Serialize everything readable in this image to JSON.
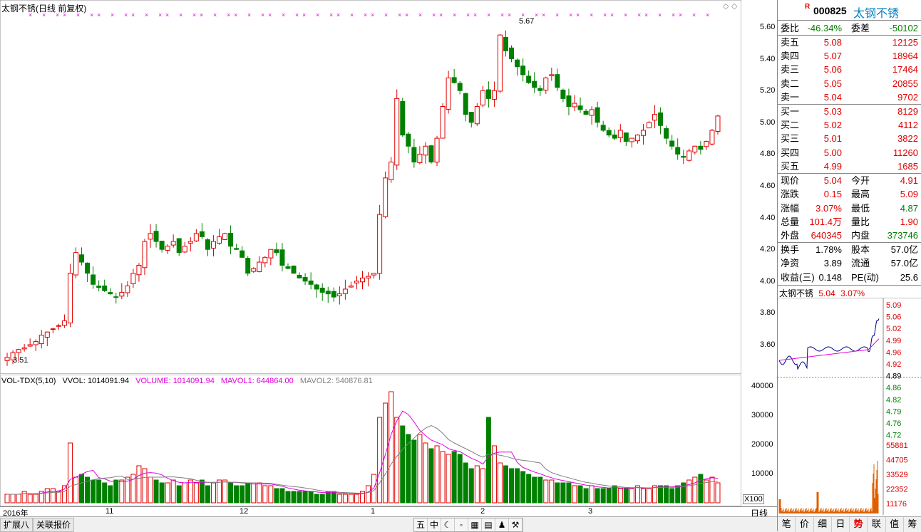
{
  "main_chart": {
    "title": "太钢不锈(日线 前复权)",
    "high_label": "5.67",
    "low_label": "3.51",
    "price_ticks": [
      "5.60",
      "5.40",
      "5.20",
      "5.00",
      "4.80",
      "4.60",
      "4.40",
      "4.20",
      "4.00",
      "3.80",
      "3.60"
    ],
    "date_labels": [
      "2016年",
      "11",
      "12",
      "1",
      "2",
      "3"
    ],
    "period": "日线"
  },
  "volume_chart": {
    "indicator": "VOL-TDX(5,10)",
    "vvol": "VVOL: 1014091.94",
    "volume": "VOLUME: 1014091.94",
    "mavol1": "MAVOL1: 644864.00",
    "mavol2": "MAVOL2: 540876.81",
    "ticks": [
      "40000",
      "30000",
      "20000",
      "10000"
    ],
    "unit": "X100"
  },
  "bottom_bar": {
    "tab1": "扩展八",
    "tab2": "关联报价",
    "tools": [
      "五",
      "中",
      "☾",
      "◦",
      "▦",
      "▤",
      "♟",
      "⚒"
    ]
  },
  "quote": {
    "code": "000825",
    "name": "太钢不锈",
    "badge": "R",
    "weibi_label": "委比",
    "weibi": "-46.34%",
    "weicha_label": "委差",
    "weicha": "-50102",
    "asks": [
      {
        "label": "卖五",
        "price": "5.08",
        "vol": "12125"
      },
      {
        "label": "卖四",
        "price": "5.07",
        "vol": "18964"
      },
      {
        "label": "卖三",
        "price": "5.06",
        "vol": "17464"
      },
      {
        "label": "卖二",
        "price": "5.05",
        "vol": "20855"
      },
      {
        "label": "卖一",
        "price": "5.04",
        "vol": "9702"
      }
    ],
    "bids": [
      {
        "label": "买一",
        "price": "5.03",
        "vol": "8129"
      },
      {
        "label": "买二",
        "price": "5.02",
        "vol": "4112"
      },
      {
        "label": "买三",
        "price": "5.01",
        "vol": "3822"
      },
      {
        "label": "买四",
        "price": "5.00",
        "vol": "11260"
      },
      {
        "label": "买五",
        "price": "4.99",
        "vol": "1685"
      }
    ],
    "stats1": [
      {
        "l1": "现价",
        "v1": "5.04",
        "c1": "red",
        "l2": "今开",
        "v2": "4.91",
        "c2": "red"
      },
      {
        "l1": "涨跌",
        "v1": "0.15",
        "c1": "red",
        "l2": "最高",
        "v2": "5.09",
        "c2": "red"
      },
      {
        "l1": "涨幅",
        "v1": "3.07%",
        "c1": "red",
        "l2": "最低",
        "v2": "4.87",
        "c2": "green"
      },
      {
        "l1": "总量",
        "v1": "101.4万",
        "c1": "red",
        "l2": "量比",
        "v2": "1.90",
        "c2": "red"
      },
      {
        "l1": "外盘",
        "v1": "640345",
        "c1": "red",
        "l2": "内盘",
        "v2": "373746",
        "c2": "green"
      }
    ],
    "stats2": [
      {
        "l1": "换手",
        "v1": "1.78%",
        "c1": "blk",
        "l2": "股本",
        "v2": "57.0亿",
        "c2": "blk"
      },
      {
        "l1": "净资",
        "v1": "3.89",
        "c1": "blk",
        "l2": "流通",
        "v2": "57.0亿",
        "c2": "blk"
      },
      {
        "l1": "收益(三)",
        "v1": "0.148",
        "c1": "blk",
        "l2": "PE(动)",
        "v2": "25.6",
        "c2": "blk"
      }
    ]
  },
  "mini_chart": {
    "name": "太钢不锈",
    "price": "5.04",
    "change": "3.07%",
    "price_ticks": [
      "5.09",
      "5.06",
      "5.02",
      "4.99",
      "4.96",
      "4.92",
      "4.89",
      "4.86",
      "4.82",
      "4.79",
      "4.76",
      "4.72"
    ],
    "vol_ticks": [
      "55881",
      "44705",
      "33529",
      "22352",
      "11176"
    ]
  },
  "right_tabs": [
    "笔",
    "价",
    "细",
    "日",
    "势",
    "联",
    "值",
    "筹"
  ],
  "colors": {
    "up": "#e00000",
    "down": "#008000",
    "ma1": "#e000e0",
    "ma2": "#808080"
  }
}
